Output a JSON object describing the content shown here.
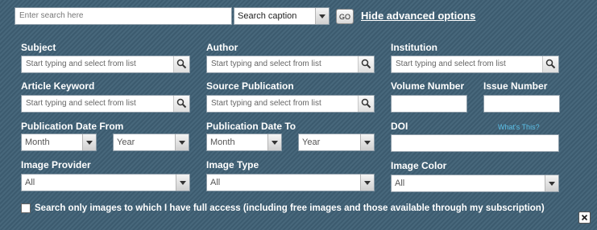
{
  "search": {
    "placeholder": "Enter search here",
    "scope_selected": "Search caption",
    "go_label": "GO",
    "toggle_link": "Hide advanced options"
  },
  "fields": {
    "subject": {
      "label": "Subject",
      "placeholder": "Start typing and select from list"
    },
    "author": {
      "label": "Author",
      "placeholder": "Start typing and select from list"
    },
    "institution": {
      "label": "Institution",
      "placeholder": "Start typing and select from list"
    },
    "article_keyword": {
      "label": "Article Keyword",
      "placeholder": "Start typing and select from list"
    },
    "source_publication": {
      "label": "Source Publication",
      "placeholder": "Start typing and select from list"
    },
    "volume_number": {
      "label": "Volume Number"
    },
    "issue_number": {
      "label": "Issue Number"
    },
    "date_from": {
      "label": "Publication Date From",
      "month": "Month",
      "year": "Year"
    },
    "date_to": {
      "label": "Publication Date To",
      "month": "Month",
      "year": "Year"
    },
    "doi": {
      "label": "DOI",
      "help_link": "What's This?"
    },
    "image_provider": {
      "label": "Image Provider",
      "selected": "All"
    },
    "image_type": {
      "label": "Image Type",
      "selected": "All"
    },
    "image_color": {
      "label": "Image Color",
      "selected": "All"
    }
  },
  "full_access": {
    "label": "Search only images to which I have full access (including free images and those available through my subscription)",
    "checked": false
  },
  "icons": {
    "search_field_icon": "magnifier-icon",
    "close": "close-icon"
  },
  "colors": {
    "background": "#3f6075",
    "label": "#ffffff",
    "help_link": "#5bc0e8"
  }
}
